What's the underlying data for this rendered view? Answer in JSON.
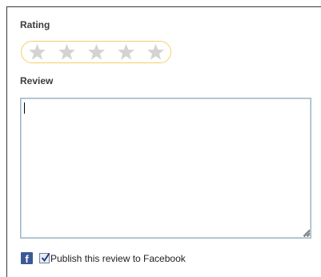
{
  "rating": {
    "label": "Rating",
    "value": 0,
    "max": 5,
    "star_color": "#d3d3d3",
    "border_color": "#f3cf6b"
  },
  "review": {
    "label": "Review",
    "value": "",
    "placeholder": ""
  },
  "facebook": {
    "icon": "facebook-icon",
    "icon_glyph": "f",
    "checked": true,
    "label": "Publish this review to Facebook",
    "brand_color": "#3b5998"
  }
}
